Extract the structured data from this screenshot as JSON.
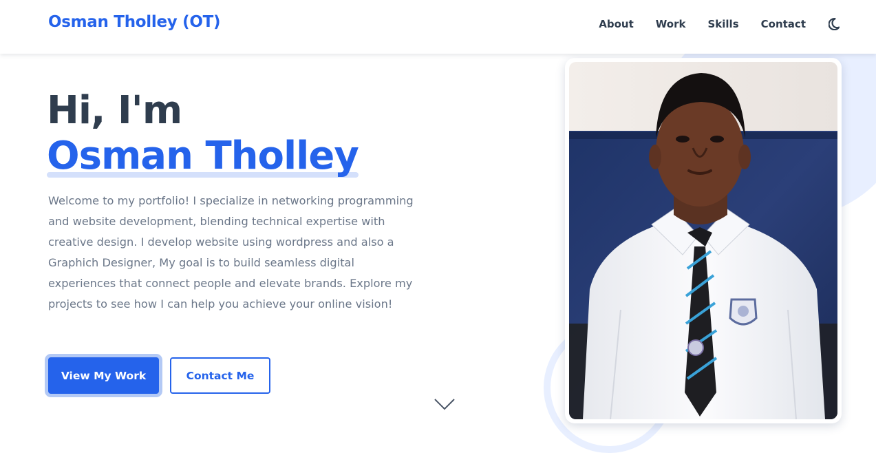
{
  "header": {
    "logo": "Osman Tholley (OT)",
    "nav": [
      {
        "label": "About"
      },
      {
        "label": "Work"
      },
      {
        "label": "Skills"
      },
      {
        "label": "Contact"
      }
    ],
    "theme_toggle_icon": "moon-icon"
  },
  "hero": {
    "greeting": "Hi, I'm",
    "name": "Osman Tholley",
    "description": "Welcome to my portfolio! I specialize in networking programming and website development, blending technical expertise with creative design. I develop website using wordpress and also a Graphich Designer, My goal is to build seamless digital experiences that connect people and elevate brands. Explore my projects to see how I can help you achieve your online vision!",
    "primary_button": "View My Work",
    "secondary_button": "Contact Me",
    "scroll_icon": "chevron-down-icon"
  },
  "colors": {
    "accent": "#2563eb",
    "text_dark": "#2f3d4e",
    "text_muted": "#6b7789",
    "decor": "#e8efff"
  }
}
